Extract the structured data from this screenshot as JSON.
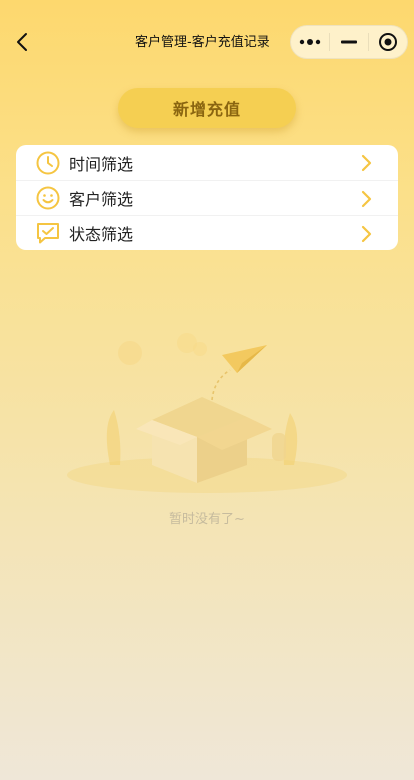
{
  "header": {
    "title": "客户管理-客户充值记录",
    "back_icon": "chevron-left-icon",
    "capsule": {
      "more_icon": "more-dots-icon",
      "minimize_icon": "minimize-icon",
      "close_icon": "target-close-icon"
    }
  },
  "actions": {
    "add_recharge_label": "新增充值"
  },
  "filters": [
    {
      "label": "时间筛选",
      "icon": "clock-icon"
    },
    {
      "label": "客户筛选",
      "icon": "smiley-icon"
    },
    {
      "label": "状态筛选",
      "icon": "chat-check-icon"
    }
  ],
  "empty_state": {
    "message": "暂时没有了~",
    "illustration": "empty-box-paper-plane-illustration"
  },
  "colors": {
    "accent": "#f5c542",
    "button_bg": "#f5cf52",
    "button_text": "#8a6510",
    "background_top": "#fdd86e",
    "background_bottom": "#efe7d8",
    "empty_text": "#c6bb9e"
  }
}
